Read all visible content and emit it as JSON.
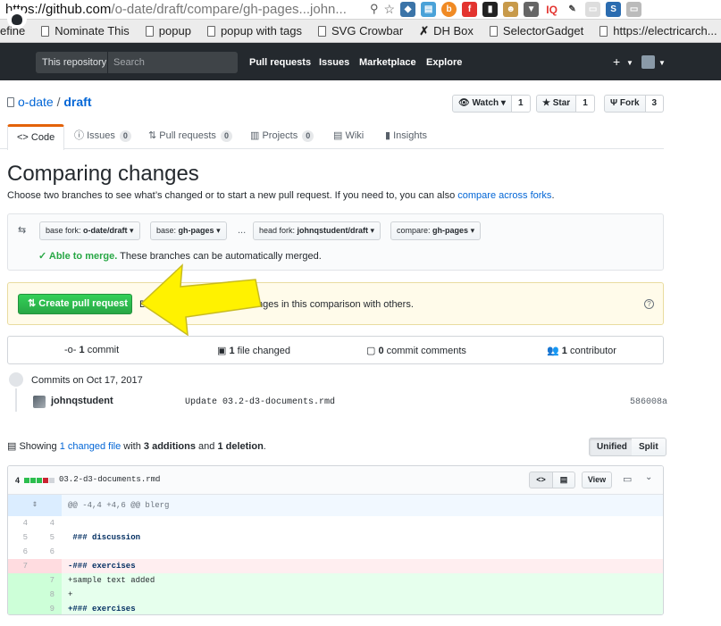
{
  "browser": {
    "url_host": "https://github.com",
    "url_path": "/o-date/draft/compare/gh-pages...john...",
    "bookmarks": [
      "efine",
      "Nominate This",
      "popup",
      "popup with tags",
      "SVG Crowbar",
      "DH Box",
      "SelectorGadget",
      "https://electricarch..."
    ]
  },
  "header": {
    "scope": "This repository",
    "search_placeholder": "Search",
    "nav": [
      "Pull requests",
      "Issues",
      "Marketplace",
      "Explore"
    ],
    "plus": "+"
  },
  "repo": {
    "owner": "o-date",
    "name": "draft",
    "watch_label": "Watch",
    "watch_count": "1",
    "star_label": "Star",
    "star_count": "1",
    "fork_label": "Fork",
    "fork_count": "3"
  },
  "tabs": [
    {
      "label": "Code"
    },
    {
      "label": "Issues",
      "count": "0"
    },
    {
      "label": "Pull requests",
      "count": "0"
    },
    {
      "label": "Projects",
      "count": "0"
    },
    {
      "label": "Wiki"
    },
    {
      "label": "Insights"
    }
  ],
  "compare": {
    "title": "Comparing changes",
    "subtitle": "Choose two branches to see what’s changed or to start a new pull request. If you need to, you can also",
    "subtitle_link": "compare across forks",
    "subtitle_end": ".",
    "base_fork_label": "base fork:",
    "base_fork": "o-date/draft",
    "base_label": "base:",
    "base": "gh-pages",
    "ellipsis": "...",
    "head_fork_label": "head fork:",
    "head_fork": "johnqstudent/draft",
    "compare_label": "compare:",
    "compare_branch": "gh-pages",
    "merge_status": "Able to merge.",
    "merge_text": "These branches can be automatically merged."
  },
  "pr": {
    "button": "Create pull request",
    "desc_start": "D",
    "desc_end": "the changes in this comparison with others.",
    "help": "?"
  },
  "stats": {
    "commits": "1",
    "commits_label": "commit",
    "files": "1",
    "files_label": "file changed",
    "comments": "0",
    "comments_label": "commit comments",
    "contributors": "1",
    "contributors_label": "contributor"
  },
  "commits": {
    "date": "Commits on Oct 17, 2017",
    "author": "johnqstudent",
    "message": "Update 03.2-d3-documents.rmd",
    "sha": "586008a"
  },
  "diff_summary": {
    "prefix": "Showing",
    "changed_files": "1 changed file",
    "with": "with",
    "additions": "3 additions",
    "and": "and",
    "deletions": "1 deletion",
    "period": ".",
    "unified": "Unified",
    "split": "Split"
  },
  "file": {
    "count": "4",
    "name": "03.2-d3-documents.rmd",
    "code_view": "<>",
    "view_label": "View",
    "hunk": "@@ -4,4 +4,6 @@ blerg",
    "lines": [
      {
        "type": "ctx",
        "old": "4",
        "new": "4",
        "text": ""
      },
      {
        "type": "ctx",
        "old": "5",
        "new": "5",
        "text": " ### discussion"
      },
      {
        "type": "ctx",
        "old": "6",
        "new": "6",
        "text": ""
      },
      {
        "type": "del",
        "old": "7",
        "new": "",
        "text": "-### exercises"
      },
      {
        "type": "add",
        "old": "",
        "new": "7",
        "text": "+sample text added"
      },
      {
        "type": "add",
        "old": "",
        "new": "8",
        "text": "+"
      },
      {
        "type": "add",
        "old": "",
        "new": "9",
        "text": "+### exercises"
      }
    ]
  },
  "colors": {
    "gh_dark": "#24292e",
    "link": "#0366d6",
    "green": "#28a745",
    "arrow": "#fff200"
  }
}
